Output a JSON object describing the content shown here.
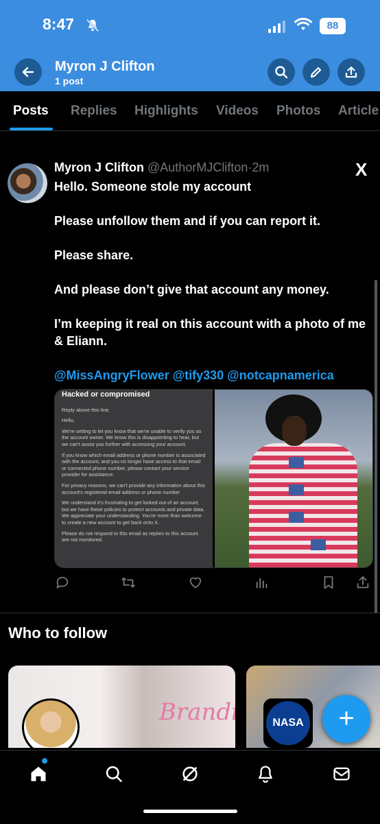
{
  "status_bar": {
    "time": "8:47",
    "battery": "88"
  },
  "header": {
    "title": "Myron J Clifton",
    "subtitle": "1 post"
  },
  "tabs": [
    "Posts",
    "Replies",
    "Highlights",
    "Videos",
    "Photos",
    "Article"
  ],
  "tweet": {
    "name": "Myron J Clifton",
    "handle": "@AuthorMJClifton",
    "sep": "·",
    "time": "2m",
    "paragraphs": [
      "Hello. Someone stole my account",
      "Please unfollow them and if you can report it.",
      "Please share.",
      "And please don’t give that account any money.",
      "I’m keeping it real on this account with a photo of me & Eliann.",
      "@MissAngryFlower @tify330 @notcapnamerica"
    ],
    "email": {
      "heading": "Hacked or compromised",
      "lines": [
        "Reply above this line.",
        "Hello,",
        "We're writing to let you know that we're unable to verify you as the account owner. We know this is disappointing to hear, but we can't assist you further with accessing your account.",
        "If you know which email address or phone number is associated with the account, and you no longer have access to that email or connected phone number, please contact your service provider for assistance.",
        "For privacy reasons, we can't provide any information about this account's registered email address or phone number",
        "We understand it's frustrating to get locked out of an account, but we have these policies to protect accounts and private data. We appreciate your understanding. You're more than welcome to create a new account to get back onto X.",
        "Please do not respond to this email as replies to this account are not monitored."
      ]
    },
    "logo": "X"
  },
  "who_to_follow": {
    "title": "Who to follow",
    "card1_script": "Brandi",
    "card2_logo": "NASA"
  },
  "fab": "+"
}
